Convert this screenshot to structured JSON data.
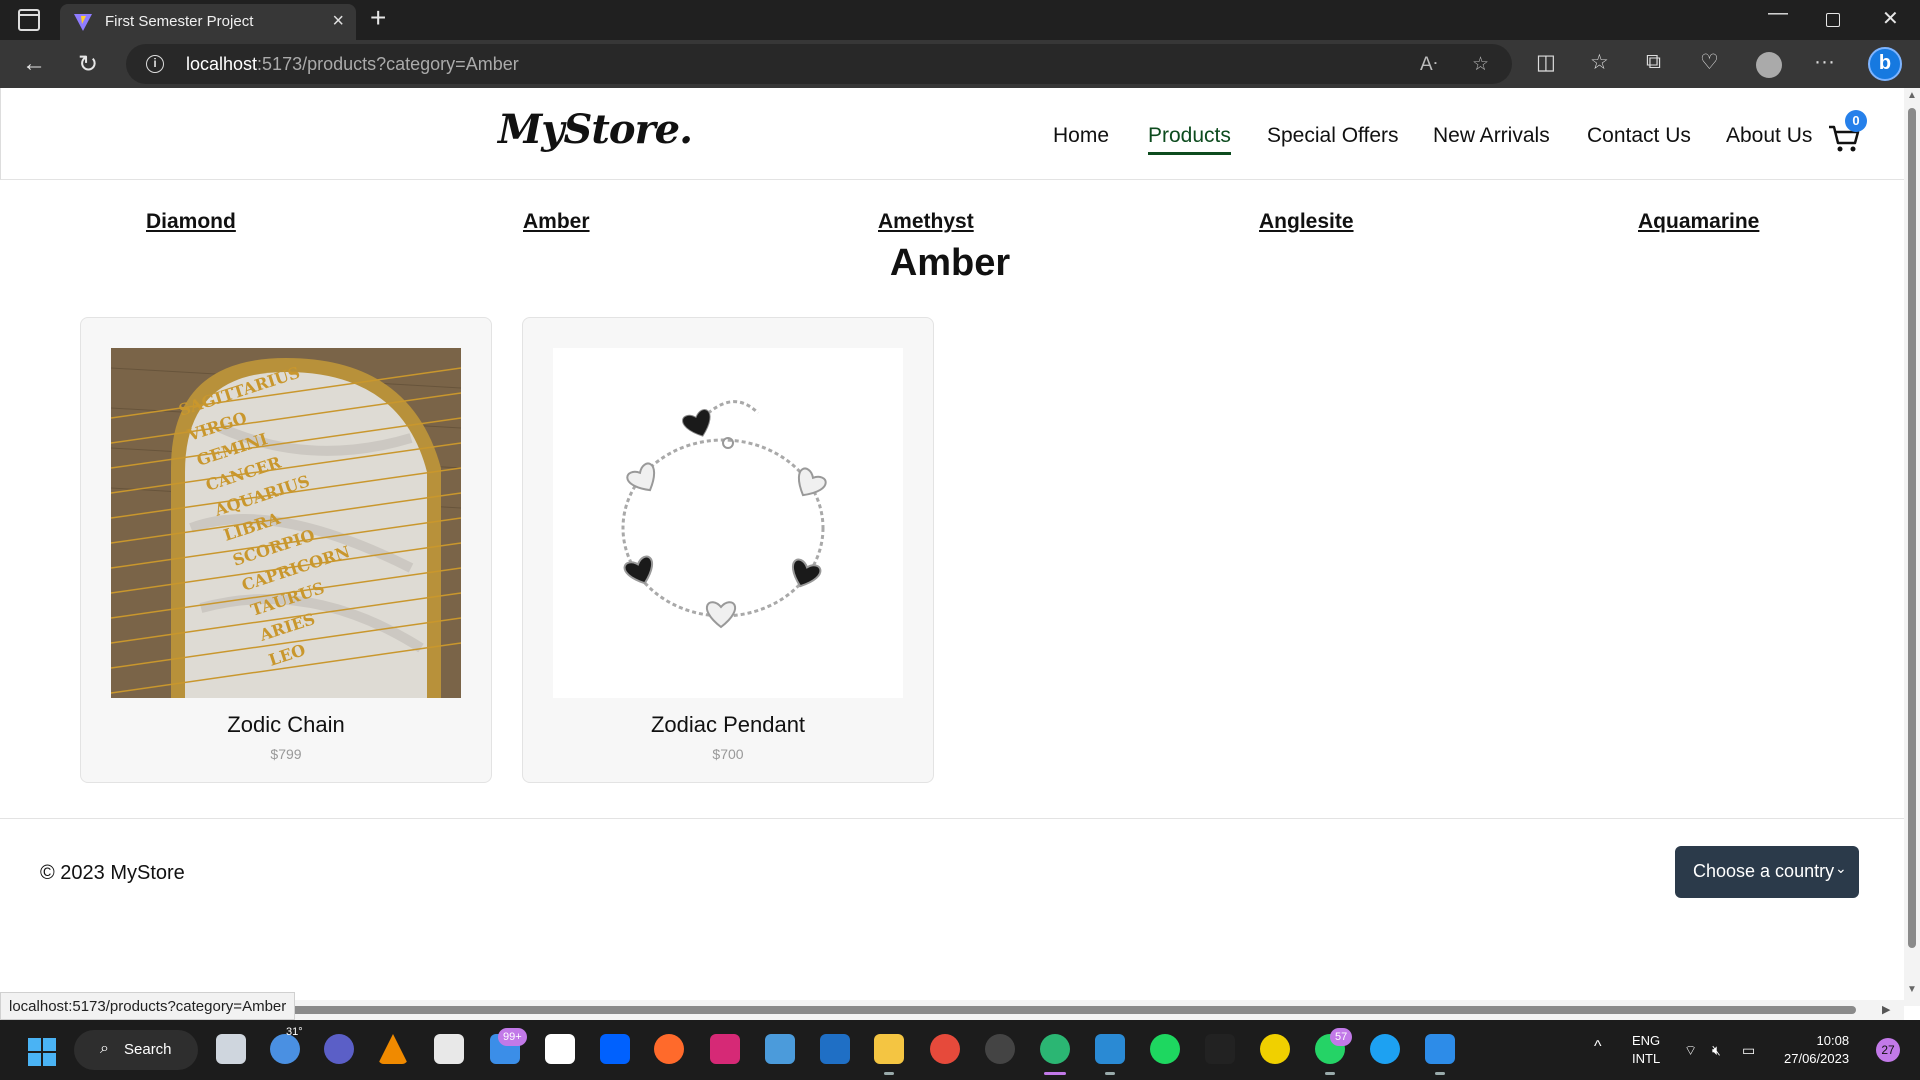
{
  "browser": {
    "tab_title": "First Semester Project",
    "url_host": "localhost",
    "url_rest": ":5173/products?category=Amber",
    "status_url": "localhost:5173/products?category=Amber"
  },
  "header": {
    "logo": "MyStore.",
    "nav": [
      "Home",
      "Products",
      "Special Offers",
      "New Arrivals",
      "Contact Us",
      "About Us"
    ],
    "active_nav": "Products",
    "cart_count": "0"
  },
  "categories": [
    "Diamond",
    "Amber",
    "Amethyst",
    "Anglesite",
    "Aquamarine"
  ],
  "current_category": "Amber",
  "products": [
    {
      "name": "Zodic Chain",
      "price": "$799",
      "image": "zodiac-name-necklaces"
    },
    {
      "name": "Zodiac Pendant",
      "price": "$700",
      "image": "heart-charm-bracelet"
    }
  ],
  "necklace_words": [
    "SAGITTARIUS",
    "VIRGO",
    "GEMINI",
    "CANCER",
    "AQUARIUS",
    "LIBRA",
    "SCORPIO",
    "CAPRICORN",
    "TAURUS",
    "ARIES",
    "LEO"
  ],
  "footer": {
    "copyright": "© 2023 MyStore",
    "country_select": "Choose a country"
  },
  "taskbar": {
    "search_label": "Search",
    "weather_temp": "31°",
    "mail_badge": "99+",
    "whatsapp_badge": "57",
    "language": "ENG",
    "keyboard": "INTL",
    "time": "10:08",
    "date": "27/06/2023",
    "notification_count": "27"
  },
  "colors": {
    "active_nav": "#0d4b1e",
    "cart_badge": "#2680ea",
    "select_bg": "#2b3a4a"
  }
}
